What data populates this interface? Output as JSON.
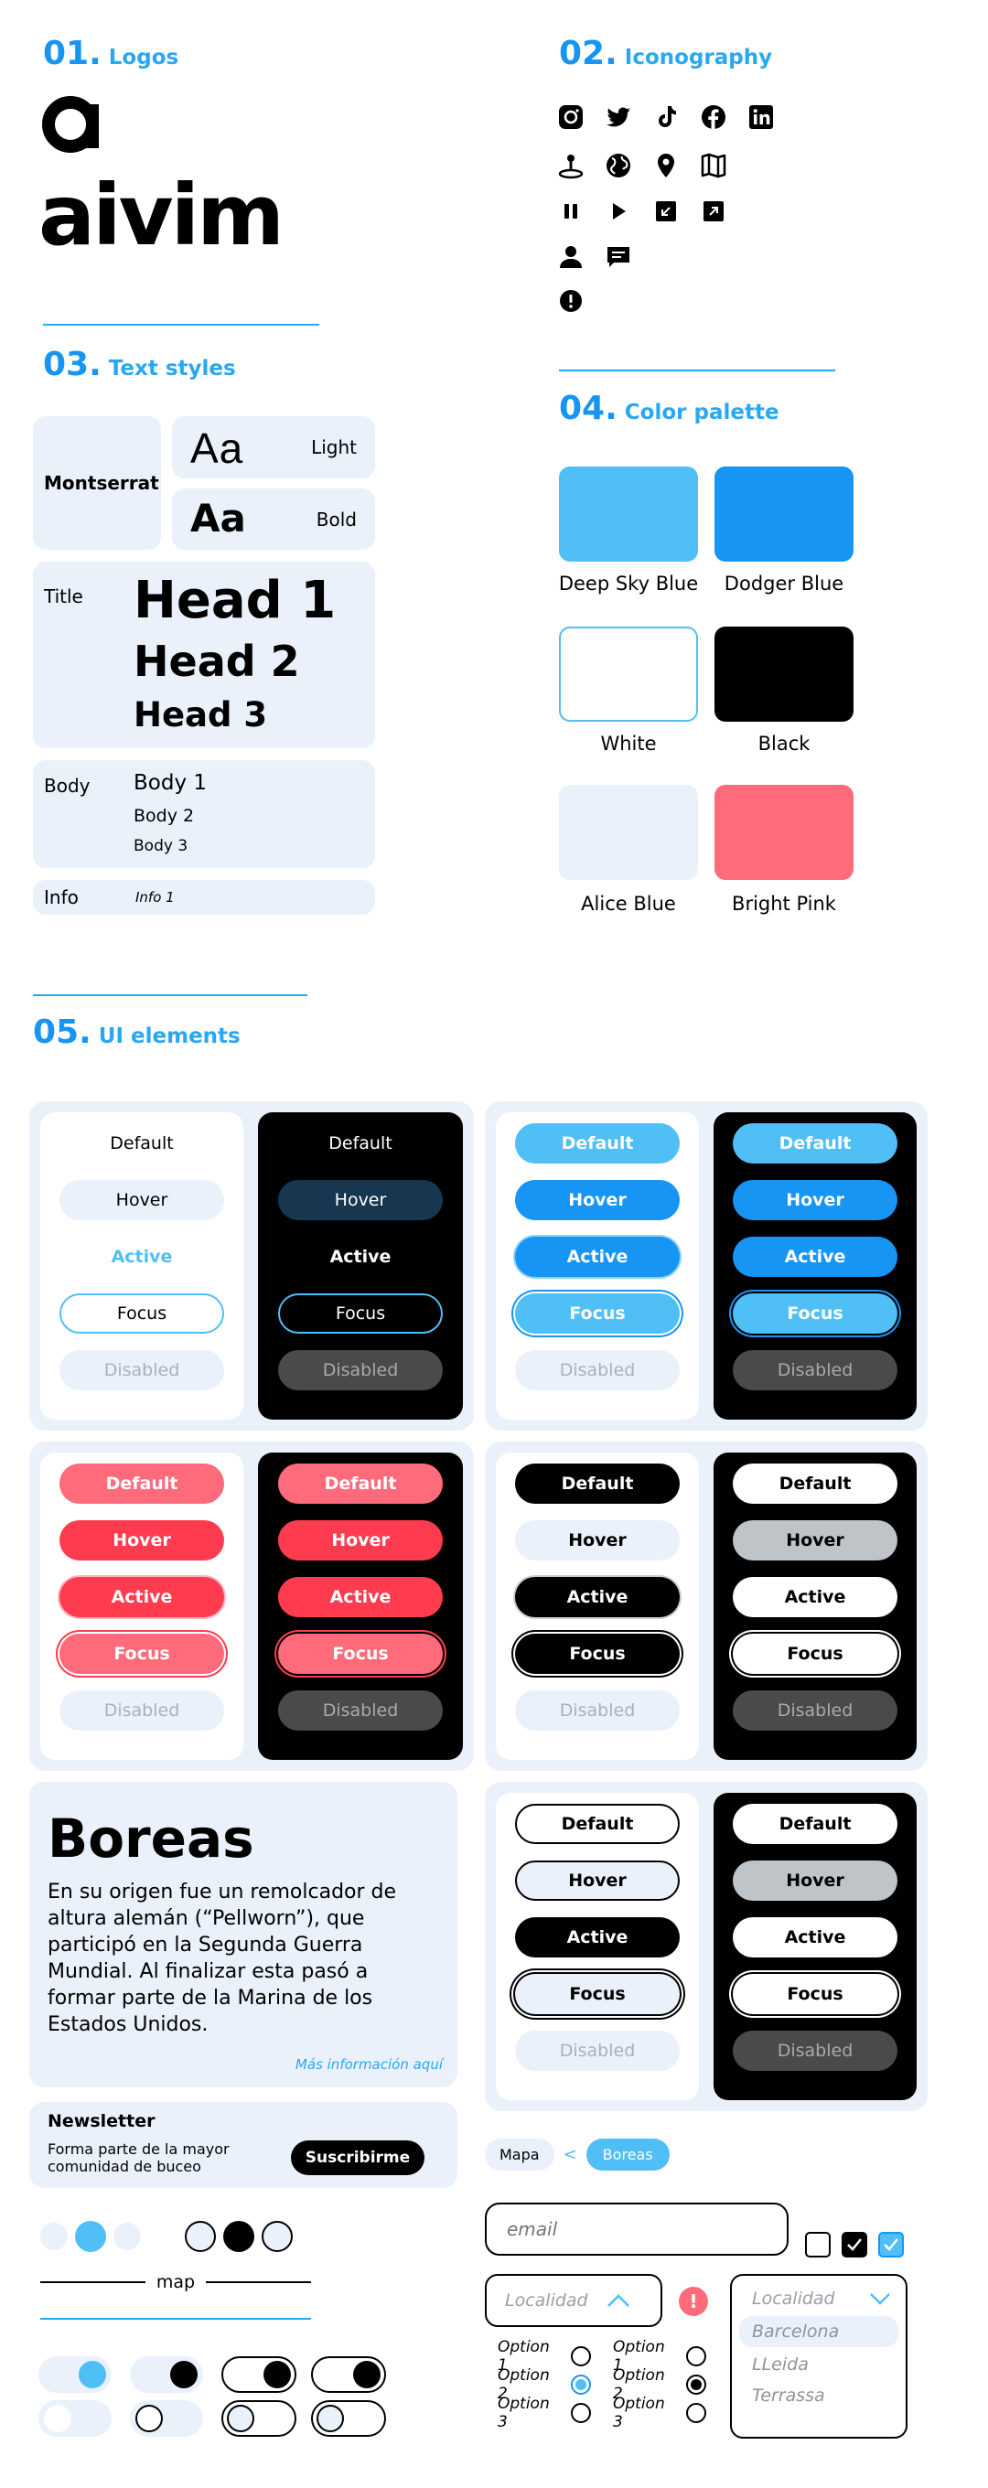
{
  "sections": {
    "logos": {
      "num": "01.",
      "name": "Logos"
    },
    "iconography": {
      "num": "02.",
      "name": "Iconography"
    },
    "text_styles": {
      "num": "03.",
      "name": "Text styles"
    },
    "color_palette": {
      "num": "04.",
      "name": "Color palette"
    },
    "ui_elements": {
      "num": "05.",
      "name": "UI elements"
    }
  },
  "logo": {
    "mark": "a",
    "wordmark": "aivim"
  },
  "icons": [
    [
      "instagram-icon",
      "twitter-icon",
      "tiktok-icon",
      "facebook-icon",
      "linkedin-icon"
    ],
    [
      "map-pin-person-icon",
      "globe-icon",
      "location-pin-icon",
      "map-icon"
    ],
    [
      "pause-icon",
      "play-icon",
      "minimize-icon",
      "expand-icon"
    ],
    [
      "user-icon",
      "chat-icon"
    ],
    [
      "alert-icon"
    ]
  ],
  "text_styles": {
    "font_name": "Montserrat",
    "sample": "Aa",
    "light_label": "Light",
    "bold_label": "Bold",
    "title_label": "Title",
    "head1": "Head 1",
    "head2": "Head 2",
    "head3": "Head 3",
    "body_label": "Body",
    "body1": "Body 1",
    "body2": "Body 2",
    "body3": "Body 3",
    "info_label": "Info",
    "info1": "Info 1"
  },
  "palette": [
    {
      "name": "Deep Sky Blue",
      "color": "#4fbff5"
    },
    {
      "name": "Dodger Blue",
      "color": "#1695f5"
    },
    {
      "name": "White",
      "color": "#ffffff"
    },
    {
      "name": "Black",
      "color": "#000000"
    },
    {
      "name": "Alice Blue",
      "color": "#eaf1fb"
    },
    {
      "name": "Bright Pink",
      "color": "#ff6b7a"
    }
  ],
  "button_states": [
    "Default",
    "Hover",
    "Active",
    "Focus",
    "Disabled"
  ],
  "card": {
    "title": "Boreas",
    "text": "En su origen fue un remolcador de altura alemán (“Pellworn”), que participó en la Segunda Guerra Mundial. Al finalizar esta pasó a formar parte de la Marina de los Estados Unidos.",
    "link": "Más información aquí"
  },
  "newsletter": {
    "title": "Newsletter",
    "text": "Forma parte de la mayor comunidad de buceo",
    "button": "Suscribirme"
  },
  "map_label": "map",
  "breadcrumb": {
    "item1": "Mapa",
    "separator": "<",
    "item2": "Boreas"
  },
  "email_placeholder": "email",
  "select": {
    "placeholder": "Localidad",
    "options": [
      "Barcelona",
      "LLeida",
      "Terrassa"
    ]
  },
  "radio_options": [
    "Option 1",
    "Option 2",
    "Option 3"
  ],
  "colors": {
    "deep_sky_blue": "#4fbff5",
    "dodger_blue": "#1695f5",
    "alice_blue": "#eaf1fb",
    "bright_pink": "#ff6b7a",
    "pink_hover": "#ff3b4f",
    "dark_grey": "#4a4a4a",
    "mid_grey": "#bfc4c9"
  }
}
